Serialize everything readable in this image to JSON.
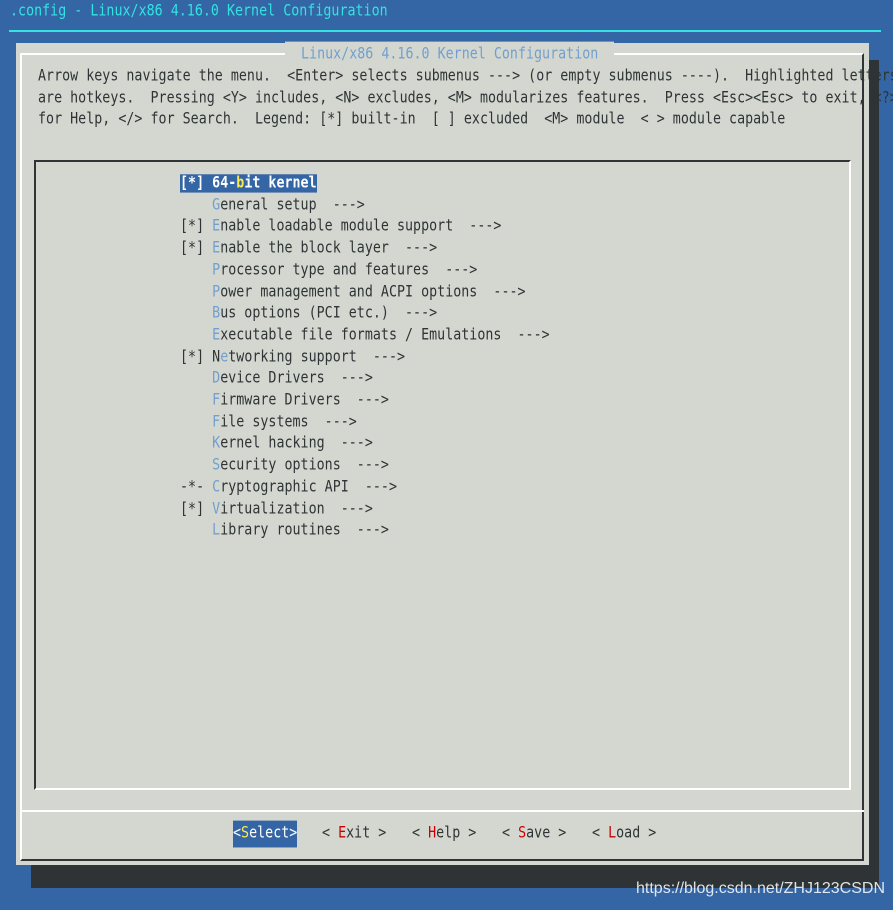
{
  "window_title": ".config - Linux/x86 4.16.0 Kernel Configuration",
  "dialog_title": "Linux/x86 4.16.0 Kernel Configuration",
  "help_lines": [
    "Arrow keys navigate the menu.  <Enter> selects submenus ---> (or empty submenus ----).  Highlighted letters",
    "are hotkeys.  Pressing <Y> includes, <N> excludes, <M> modularizes features.  Press <Esc><Esc> to exit, <?>",
    "for Help, </> for Search.  Legend: [*] built-in  [ ] excluded  <M> module  < > module capable"
  ],
  "menu_items": [
    {
      "prefix": "[*] ",
      "pre": "64-",
      "hotkey": "b",
      "rest": "it kernel",
      "selected": true
    },
    {
      "prefix": "    ",
      "pre": "",
      "hotkey": "G",
      "rest": "eneral setup  --->"
    },
    {
      "prefix": "[*] ",
      "pre": "",
      "hotkey": "E",
      "rest": "nable loadable module support  --->"
    },
    {
      "prefix": "[*] ",
      "pre": "",
      "hotkey": "E",
      "rest": "nable the block layer  --->"
    },
    {
      "prefix": "    ",
      "pre": "",
      "hotkey": "P",
      "rest": "rocessor type and features  --->"
    },
    {
      "prefix": "    ",
      "pre": "",
      "hotkey": "P",
      "rest": "ower management and ACPI options  --->"
    },
    {
      "prefix": "    ",
      "pre": "",
      "hotkey": "B",
      "rest": "us options (PCI etc.)  --->"
    },
    {
      "prefix": "    ",
      "pre": "",
      "hotkey": "E",
      "rest": "xecutable file formats / Emulations  --->"
    },
    {
      "prefix": "[*] ",
      "pre": "N",
      "hotkey": "e",
      "rest": "tworking support  --->"
    },
    {
      "prefix": "    ",
      "pre": "",
      "hotkey": "D",
      "rest": "evice Drivers  --->"
    },
    {
      "prefix": "    ",
      "pre": "",
      "hotkey": "F",
      "rest": "irmware Drivers  --->"
    },
    {
      "prefix": "    ",
      "pre": "",
      "hotkey": "F",
      "rest": "ile systems  --->"
    },
    {
      "prefix": "    ",
      "pre": "",
      "hotkey": "K",
      "rest": "ernel hacking  --->"
    },
    {
      "prefix": "    ",
      "pre": "",
      "hotkey": "S",
      "rest": "ecurity options  --->"
    },
    {
      "prefix": "-*- ",
      "pre": "",
      "hotkey": "C",
      "rest": "ryptographic API  --->"
    },
    {
      "prefix": "[*] ",
      "pre": "",
      "hotkey": "V",
      "rest": "irtualization  --->"
    },
    {
      "prefix": "    ",
      "pre": "",
      "hotkey": "L",
      "rest": "ibrary routines  --->"
    }
  ],
  "buttons": [
    {
      "open": "<",
      "hotkey": "S",
      "rest": "elect",
      "close": ">",
      "active": true
    },
    {
      "open": "< ",
      "hotkey": "E",
      "rest": "xit",
      "close": " >"
    },
    {
      "open": "< ",
      "hotkey": "H",
      "rest": "elp",
      "close": " >"
    },
    {
      "open": "< ",
      "hotkey": "S",
      "rest": "ave",
      "close": " >"
    },
    {
      "open": "< ",
      "hotkey": "L",
      "rest": "oad",
      "close": " >"
    }
  ],
  "watermark": "https://blog.csdn.net/ZHJ123CSDN",
  "colors": {
    "background": "#3465a4",
    "dialog": "#d3d7cf",
    "hotkey": "#729fcf",
    "button_hotkey": "#cc0000",
    "highlight_hotkey": "#fce94f"
  }
}
